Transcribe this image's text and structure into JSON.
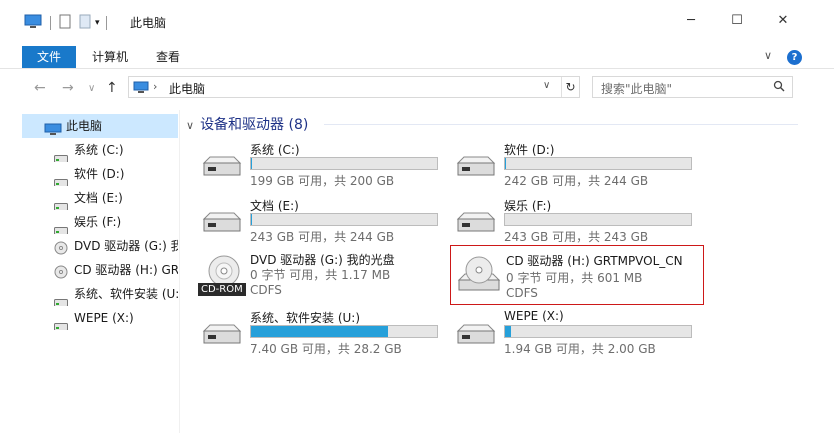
{
  "window": {
    "title": "此电脑"
  },
  "ribbon": {
    "tabs": [
      "文件",
      "计算机",
      "查看"
    ],
    "help": "?"
  },
  "address": {
    "path": "此电脑",
    "search_placeholder": "搜索\"此电脑\""
  },
  "nav": {
    "items": [
      {
        "label": "此电脑",
        "icon": "pc-icon"
      },
      {
        "label": "系统 (C:)",
        "icon": "drive-icon"
      },
      {
        "label": "软件 (D:)",
        "icon": "drive-icon"
      },
      {
        "label": "文档 (E:)",
        "icon": "drive-icon"
      },
      {
        "label": "娱乐 (F:)",
        "icon": "drive-icon"
      },
      {
        "label": "DVD 驱动器 (G:) 我",
        "icon": "dvd-icon"
      },
      {
        "label": "CD 驱动器 (H:) GRT",
        "icon": "cd-icon"
      },
      {
        "label": "系统、软件安装 (U:",
        "icon": "drive-icon"
      },
      {
        "label": "WEPE (X:)",
        "icon": "drive-icon"
      }
    ]
  },
  "group": {
    "title": "设备和驱动器 (8)"
  },
  "drives": [
    {
      "name": "系统 (C:)",
      "size": "199 GB 可用，共 200 GB",
      "used": 0.005
    },
    {
      "name": "软件 (D:)",
      "size": "242 GB 可用，共 244 GB",
      "used": 0.008
    },
    {
      "name": "文档 (E:)",
      "size": "243 GB 可用，共 244 GB",
      "used": 0.004
    },
    {
      "name": "娱乐 (F:)",
      "size": "243 GB 可用，共 243 GB",
      "used": 0.0
    },
    {
      "name": "系统、软件安装 (U:)",
      "size": "7.40 GB 可用，共 28.2 GB",
      "used": 0.738
    },
    {
      "name": "WEPE (X:)",
      "size": "1.94 GB 可用，共 2.00 GB",
      "used": 0.03
    }
  ],
  "optical": [
    {
      "name": "DVD 驱动器 (G:) 我的光盘",
      "line2": "0 字节 可用，共 1.17 MB",
      "line3": "CDFS",
      "tag": "CD-ROM"
    },
    {
      "name": "CD 驱动器 (H:) GRTMPVOL_CN",
      "line2": "0 字节 可用，共 601 MB",
      "line3": "CDFS"
    }
  ],
  "colors": {
    "accent": "#1979ca",
    "bar_fill": "#26a0da",
    "selection_border": "#cd1818",
    "nav_selected": "#cce8ff"
  }
}
